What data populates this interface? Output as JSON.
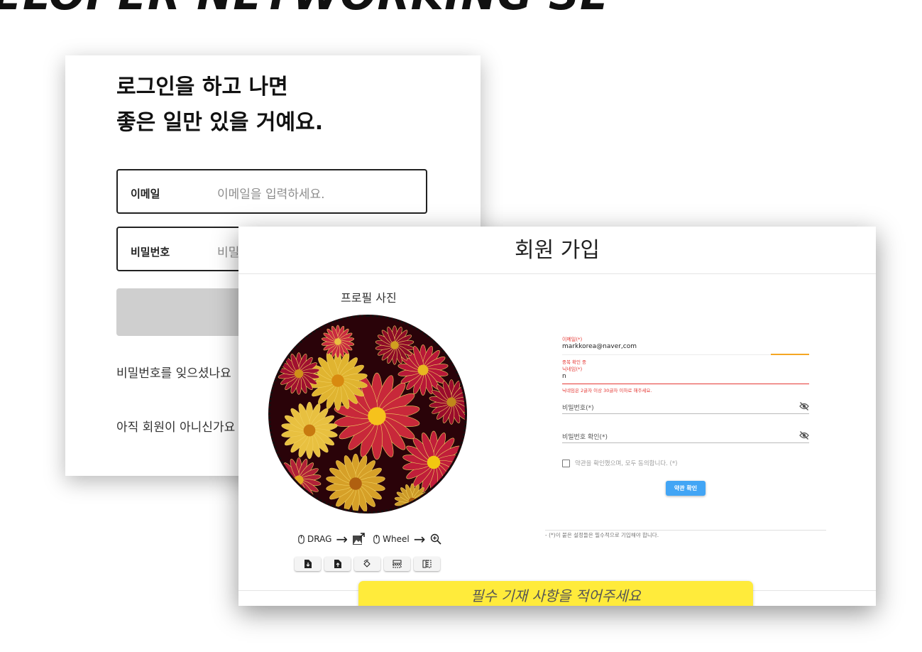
{
  "banner": {
    "text": "ELOPER NETWORKING SE"
  },
  "login": {
    "headline_line1": "로그인을 하고 나면",
    "headline_line2": "좋은 일만 있을 거예요.",
    "email_label": "이메일",
    "email_placeholder": "이메일을 입력하세요.",
    "password_label": "비밀번호",
    "password_placeholder": "비밀",
    "forgot_text": "비밀번호를 잊으셨나요",
    "not_member_text": "아직 회원이 아니신가요"
  },
  "signup": {
    "title": "회원 가입",
    "profile_label": "프로필 사진",
    "hints": {
      "drag": "DRAG",
      "wheel": "Wheel"
    },
    "toolbar_icons": [
      "file-download-icon",
      "file-upload-icon",
      "rotate-icon",
      "flip-vertical-icon",
      "flip-horizontal-icon"
    ],
    "email": {
      "label": "이메일(*)",
      "value": "markkorea@naver,com",
      "help": "중복 확인 중"
    },
    "nickname": {
      "label": "닉네임(*)",
      "value": "n",
      "help": "닉네임은 2글자 이상 30글자 이하로 해주세요."
    },
    "password": {
      "label": "비밀번호(*)"
    },
    "password_confirm": {
      "label": "비밀번호 확인(*)"
    },
    "agree_label": "약관을 확인했으며, 모두 동의합니다. (*)",
    "terms_button": "약관 확인",
    "required_note": "- (*)이 붙은 설정들은 필수적으로 기입해야 합니다.",
    "warning": "필수 기재 사항을 적어주세요"
  },
  "colors": {
    "error": "#e53935",
    "primary": "#42a5f5",
    "warning_bg": "#ffeb3b",
    "input_progress": "#f5a623"
  }
}
